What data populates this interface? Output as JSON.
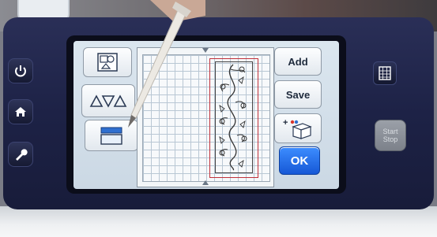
{
  "screen": {
    "buttons": {
      "add_label": "Add",
      "save_label": "Save",
      "ok_label": "OK"
    },
    "left_tools": [
      "shapes-tool",
      "triangles-tool",
      "layers-tool"
    ]
  },
  "hardware": {
    "start_stop_label_1": "Start",
    "start_stop_label_2": "Stop"
  },
  "colors": {
    "device_body": "#1d2246",
    "ok_button": "#1658d6",
    "design_frame": "#c0303a"
  }
}
